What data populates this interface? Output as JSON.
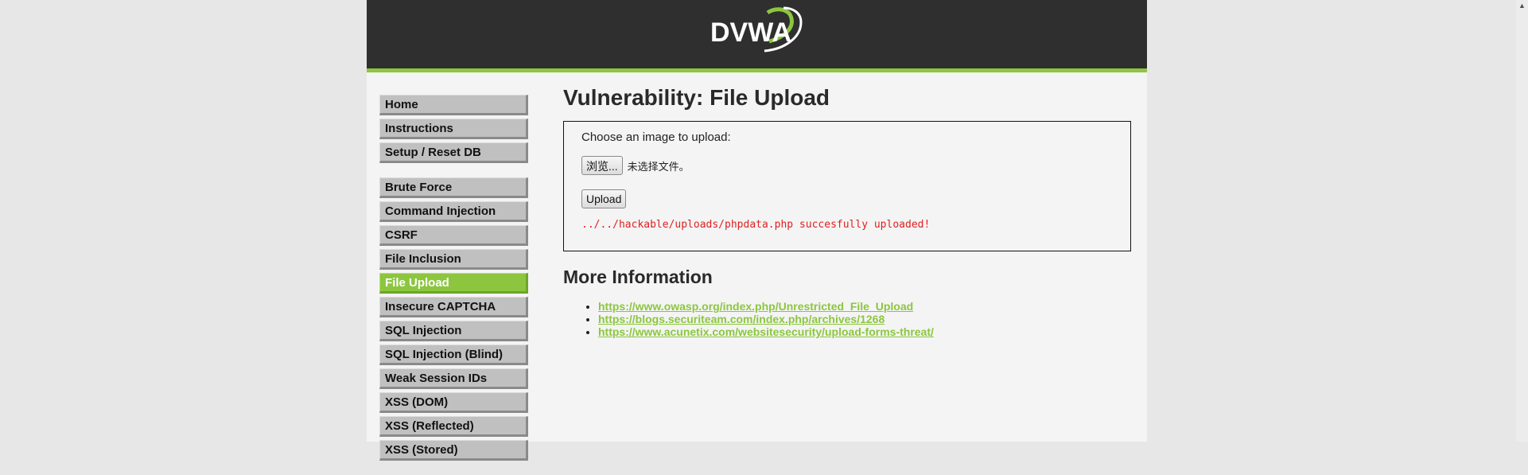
{
  "header": {
    "logo_text": "DVWA"
  },
  "menu": {
    "blocks": [
      [
        {
          "label": "Home"
        },
        {
          "label": "Instructions"
        },
        {
          "label": "Setup / Reset DB"
        }
      ],
      [
        {
          "label": "Brute Force"
        },
        {
          "label": "Command Injection"
        },
        {
          "label": "CSRF"
        },
        {
          "label": "File Inclusion"
        },
        {
          "label": "File Upload",
          "selected": true
        },
        {
          "label": "Insecure CAPTCHA"
        },
        {
          "label": "SQL Injection"
        },
        {
          "label": "SQL Injection (Blind)"
        },
        {
          "label": "Weak Session IDs"
        },
        {
          "label": "XSS (DOM)"
        },
        {
          "label": "XSS (Reflected)"
        },
        {
          "label": "XSS (Stored)"
        }
      ]
    ]
  },
  "main": {
    "title": "Vulnerability: File Upload",
    "form": {
      "prompt": "Choose an image to upload:",
      "browse_label": "浏览...",
      "no_file_text": "未选择文件。",
      "upload_label": "Upload",
      "result_message": "../../hackable/uploads/phpdata.php succesfully uploaded!"
    },
    "more_info_title": "More Information",
    "links": [
      "https://www.owasp.org/index.php/Unrestricted_File_Upload",
      "https://blogs.securiteam.com/index.php/archives/1268",
      "https://www.acunetix.com/websitesecurity/upload-forms-threat/"
    ]
  },
  "colors": {
    "accent": "#8cc63f",
    "header_bg": "#2f2f2f",
    "error_text": "#e02020"
  },
  "icons": {
    "scroll_up": "chevron-up-icon"
  }
}
